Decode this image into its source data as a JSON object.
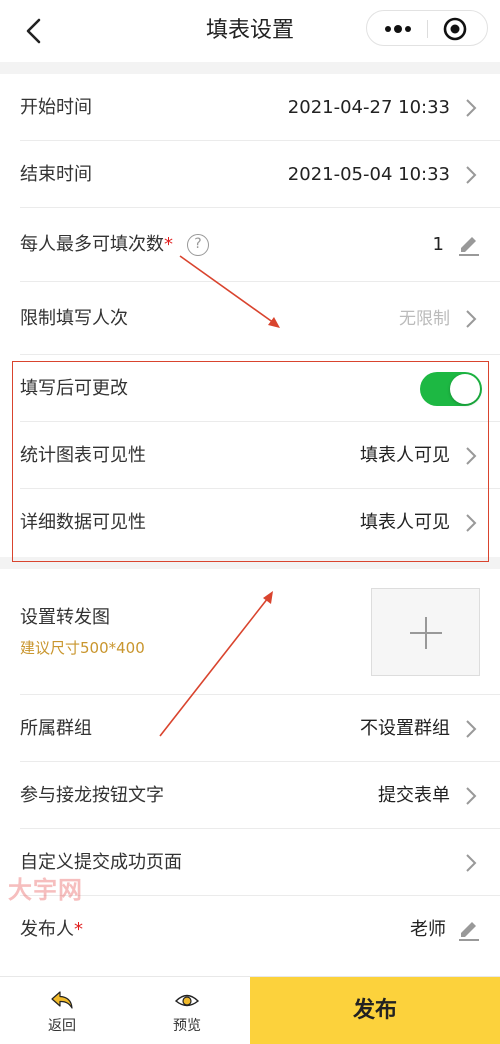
{
  "header": {
    "title": "填表设置"
  },
  "settings": {
    "start_time": {
      "label": "开始时间",
      "value": "2021-04-27 10:33"
    },
    "end_time": {
      "label": "结束时间",
      "value": "2021-05-04 10:33"
    },
    "max_times": {
      "label": "每人最多可填次数",
      "required": "*",
      "help": "?",
      "value": "1"
    },
    "limit_people": {
      "label": "限制填写人次",
      "value": "无限制"
    },
    "editable_after": {
      "label": "填写后可更改",
      "toggle_on": true
    },
    "chart_visibility": {
      "label": "统计图表可见性",
      "value": "填表人可见"
    },
    "detail_visibility": {
      "label": "详细数据可见性",
      "value": "填表人可见"
    }
  },
  "share": {
    "label": "设置转发图",
    "hint": "建议尺寸500*400"
  },
  "more": {
    "group": {
      "label": "所属群组",
      "value": "不设置群组"
    },
    "button_text": {
      "label": "参与接龙按钮文字",
      "value": "提交表单"
    },
    "success_page": {
      "label": "自定义提交成功页面"
    },
    "publisher": {
      "label": "发布人",
      "required": "*",
      "value": "老师"
    }
  },
  "watermark": "大宇网",
  "bottom": {
    "back_label": "返回",
    "preview_label": "预览",
    "publish_label": "发布"
  },
  "colors": {
    "accent": "#fcd23c",
    "toggle": "#1db843",
    "highlight": "#d9442e",
    "hint": "#c9962e"
  }
}
